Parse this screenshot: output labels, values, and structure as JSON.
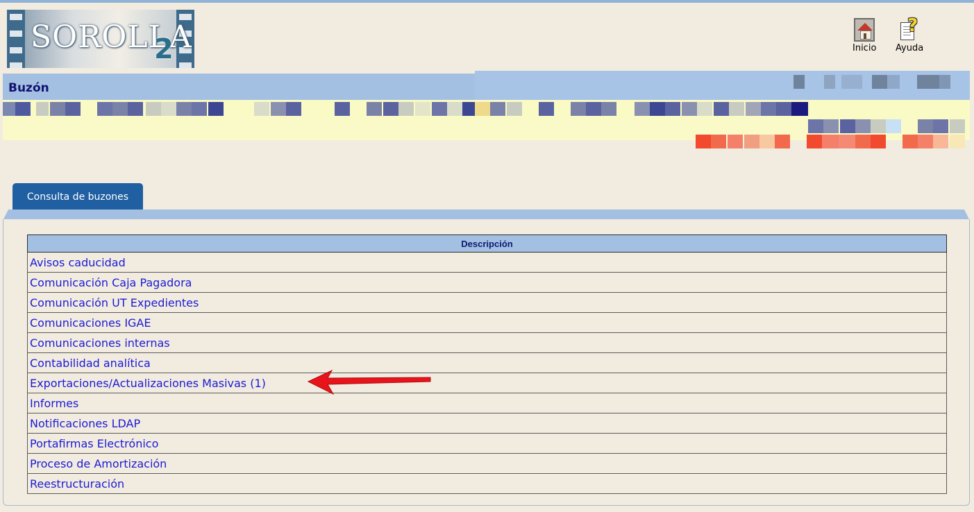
{
  "header": {
    "logo_text": "SOROLLA",
    "logo_number": "2",
    "buttons": [
      {
        "label": "Inicio",
        "icon": "home-icon"
      },
      {
        "label": "Ayuda",
        "icon": "help-icon"
      }
    ]
  },
  "page": {
    "title": "Buzón"
  },
  "tabs": [
    {
      "label": "Consulta de buzones",
      "active": true
    }
  ],
  "table": {
    "header": "Descripción",
    "rows": [
      "Avisos caducidad",
      "Comunicación Caja Pagadora",
      "Comunicación UT Expedientes",
      "Comunicaciones IGAE",
      "Comunicaciones internas",
      "Contabilidad analítica",
      "Exportaciones/Actualizaciones Masivas (1)",
      "Informes",
      "Notificaciones LDAP",
      "Portafirmas Electrónico",
      "Proceso de Amortización",
      "Reestructuración"
    ]
  },
  "annotation": {
    "arrow_target": "Exportaciones/Actualizaciones Masivas (1)",
    "arrow_color": "#e8141c"
  },
  "colors": {
    "title_bar": "#a3bfe2",
    "tab": "#1f5fa2",
    "link": "#1a1ad6",
    "background": "#f2ece0"
  }
}
